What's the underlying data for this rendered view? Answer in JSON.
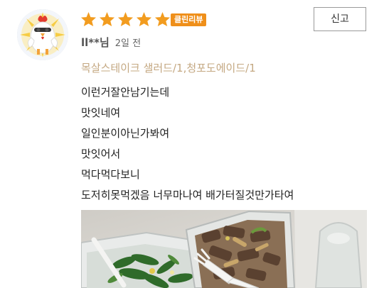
{
  "review": {
    "rating": 5,
    "rating_max": 5,
    "badge": "클린리뷰",
    "report_label": "신고",
    "username": "ll**님",
    "date": "2일 전",
    "options": "목살스테이크 샐러드/1,청포도에이드/1",
    "lines": [
      "이런거잘안남기는데",
      "맛잇네여",
      "일인분이아닌가봐여",
      "맛잇어서",
      "먹다먹다보니",
      "도저히못먹겠음 너무마나여 배가터질것만가타여"
    ],
    "avatar_icon": "chicken-avatar-icon",
    "photo_icon": "food-photo-icon"
  },
  "colors": {
    "star": "#f29c1f",
    "badge": "#ef8f1a",
    "options_text": "#c4a882"
  }
}
